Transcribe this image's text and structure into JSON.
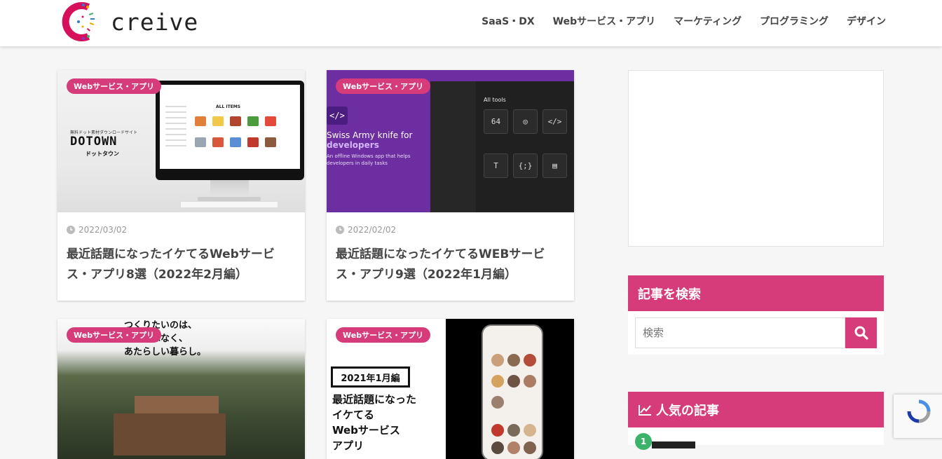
{
  "site": {
    "logo_text": "creive"
  },
  "nav": {
    "items": [
      "SaaS・DX",
      "Webサービス・アプリ",
      "マーケティング",
      "プログラミング",
      "デザイン"
    ]
  },
  "cards": [
    {
      "category": "Webサービス・アプリ",
      "date": "2022/03/02",
      "title": "最近話題になったイケてるWebサービス・アプリ8選（2022年2月編）",
      "thumb_text": {
        "brand": "DOTOWN",
        "brand_sub": "無料ドット素材ダウンロードサイト",
        "brand_kana": "ドットタウン",
        "items_heading": "ALL ITEMS"
      }
    },
    {
      "category": "Webサービス・アプリ",
      "date": "2022/02/02",
      "title": "最近話題になったイケてるWEBサービス・アプリ9選（2022年1月編）",
      "thumb_text": {
        "line1": "Swiss Army knife for",
        "line2": "developers",
        "sub": "An offline Windows app that helps developers in daily tasks",
        "panel_heading": "All tools"
      }
    },
    {
      "category": "Webサービス・アプリ",
      "date": "",
      "title": "",
      "thumb_text": {
        "headline": "つくりたいのは、\n　　　はなく、\nあたらしい暮らし。"
      }
    },
    {
      "category": "Webサービス・アプリ",
      "date": "",
      "title": "",
      "thumb_text": {
        "box": "2021年1月編",
        "headline": "最近話題になった\nイケてる\nWebサービス\nアプリ"
      }
    }
  ],
  "sidebar": {
    "search_heading": "記事を検索",
    "search_placeholder": "検索",
    "popular_heading": "人気の記事",
    "popular_first_rank": "1"
  },
  "colors": {
    "accent": "#d63b7a",
    "rank_badge": "#3bb36b"
  },
  "icons": {
    "search": "search-icon",
    "clock": "clock-icon",
    "chart": "chart-line-icon"
  }
}
